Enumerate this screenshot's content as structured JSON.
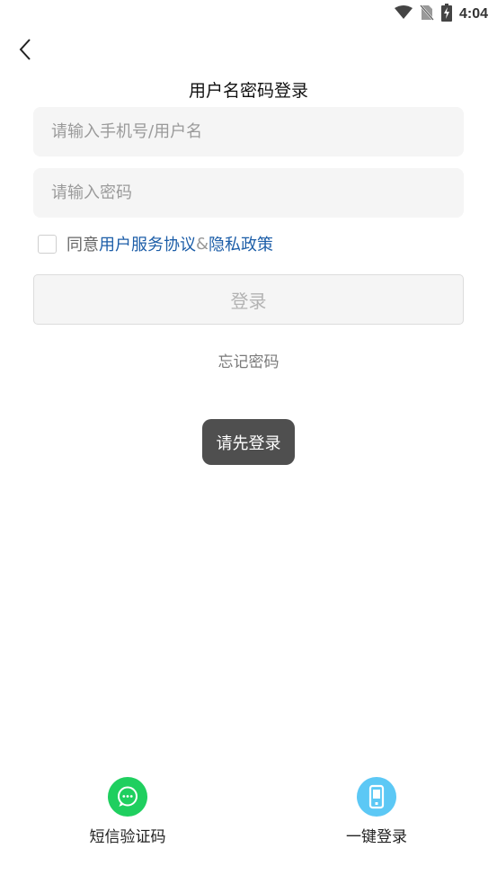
{
  "status_bar": {
    "time": "4:04",
    "icons": [
      "wifi-icon",
      "no-sim-icon",
      "battery-charging-icon"
    ]
  },
  "nav": {
    "back_icon": "chevron-left-icon"
  },
  "page": {
    "title": "用户名密码登录"
  },
  "form": {
    "username_placeholder": "请输入手机号/用户名",
    "username_value": "",
    "password_placeholder": "请输入密码",
    "password_value": "",
    "agree": {
      "checked": false,
      "prefix": "同意",
      "service_agreement": "用户服务协议",
      "separator": "&",
      "privacy_policy": "隐私政策"
    },
    "login_label": "登录",
    "forgot_password": "忘记密码"
  },
  "toast": {
    "message": "请先登录"
  },
  "alt_login": [
    {
      "label": "短信验证码",
      "icon": "chat-bubble-icon",
      "color": "#1fcf5f"
    },
    {
      "label": "一键登录",
      "icon": "phone-icon",
      "color": "#5cc8f5"
    }
  ],
  "colors": {
    "link": "#1d5ea8",
    "input_bg": "#f5f5f5",
    "toast_bg": "#4f4f4f"
  }
}
